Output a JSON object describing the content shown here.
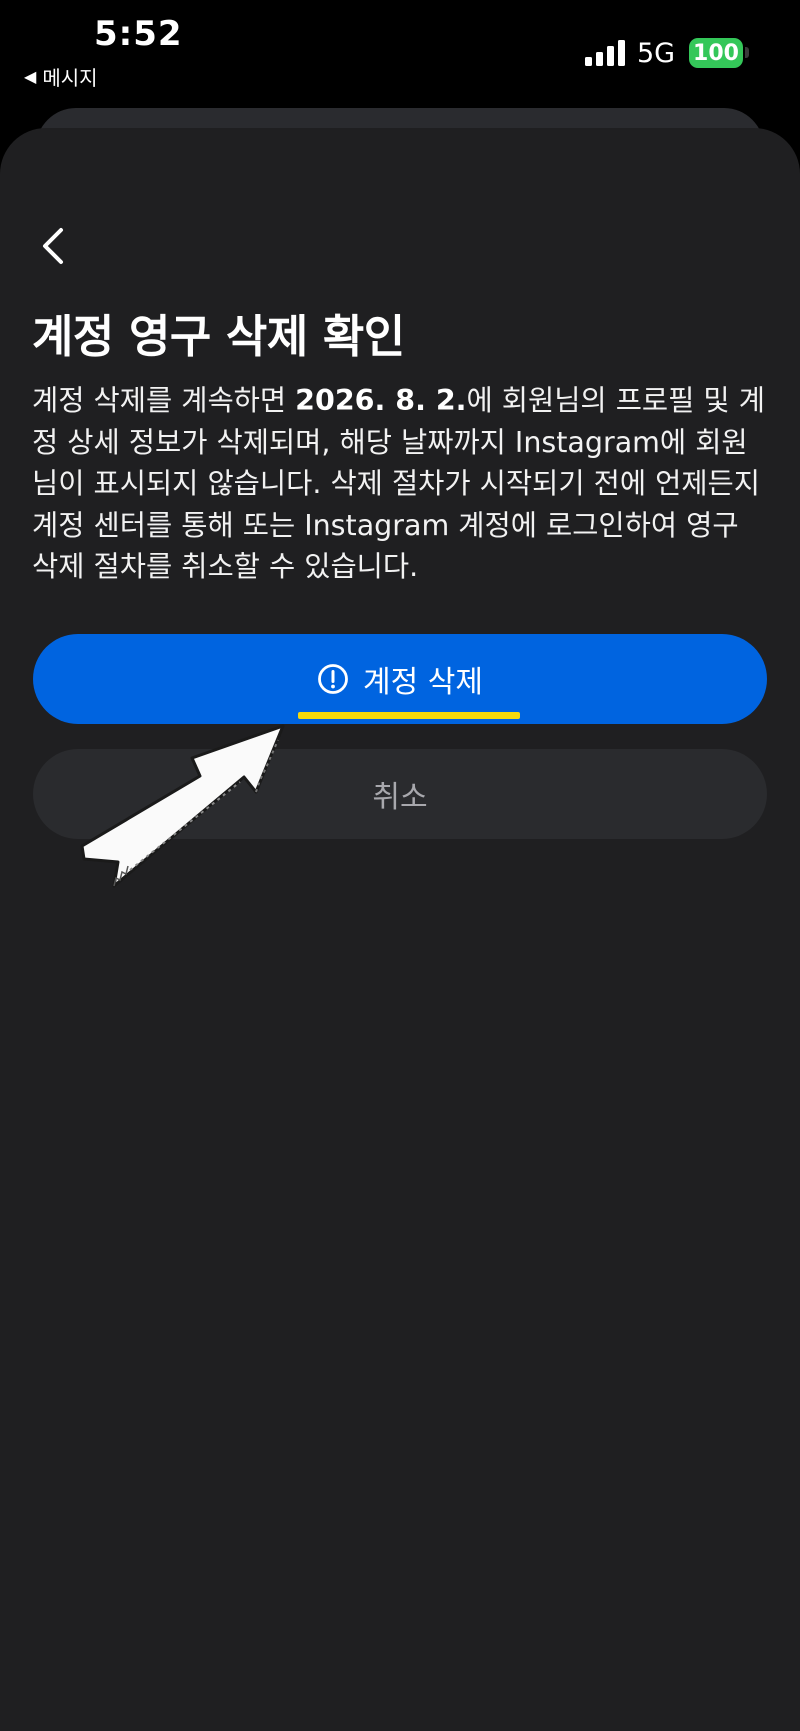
{
  "status_bar": {
    "time": "5:52",
    "back_app_label": "메시지",
    "network": "5G",
    "battery": "100"
  },
  "page": {
    "title": "계정 영구 삭제 확인",
    "description_prefix": "계정 삭제를 계속하면 ",
    "description_date": "2026. 8. 2.",
    "description_suffix": "에 회원님의 프로필 및 계정 상세 정보가 삭제되며, 해당 날짜까지 Instagram에 회원님이 표시되지 않습니다. 삭제 절차가 시작되기 전에 언제든지 계정 센터를 통해 또는 Instagram 계정에 로그인하여 영구 삭제 절차를 취소할 수 있습니다."
  },
  "buttons": {
    "delete_label": "계정 삭제",
    "cancel_label": "취소"
  },
  "colors": {
    "primary": "#0064e0",
    "highlight": "#f5d90a",
    "battery": "#34c759"
  },
  "icons": {
    "back": "chevron-left-icon",
    "alert": "exclamation-circle-icon",
    "annotation": "hand-drawn-arrow"
  }
}
